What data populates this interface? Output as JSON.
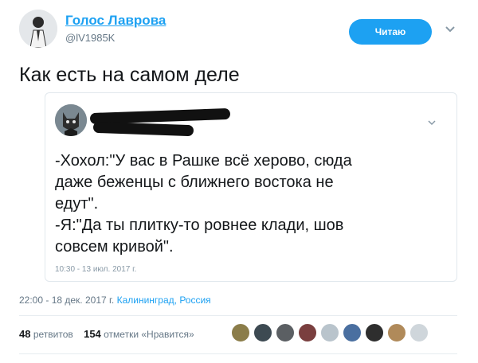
{
  "author": {
    "name": "Голос Лаврова",
    "handle": "@lV1985K"
  },
  "follow_label": "Читаю",
  "tweet_text": "Как есть на самом деле",
  "quote": {
    "lines": [
      "-Хохол:\"У вас в Рашке всё херово, сюда",
      "даже беженцы с ближнего востока не",
      "едут\".",
      "-Я:\"Да ты плитку-то ровнее клади, шов",
      "совсем кривой\"."
    ],
    "timestamp": "10:30 - 13 июл. 2017 г."
  },
  "meta": {
    "time": "22:00 - 18 дек. 2017 г.",
    "location": "Калининград, Россия"
  },
  "stats": {
    "retweets_count": "48",
    "retweets_label": "ретвитов",
    "likes_count": "154",
    "likes_label": "отметки «Нравится»"
  },
  "liker_faces": [
    "liker-1",
    "liker-2",
    "liker-3",
    "liker-4",
    "liker-5",
    "liker-6",
    "liker-7",
    "liker-8",
    "liker-9"
  ],
  "colors": {
    "accent": "#1da1f2",
    "text": "#14171a",
    "muted": "#657786"
  }
}
